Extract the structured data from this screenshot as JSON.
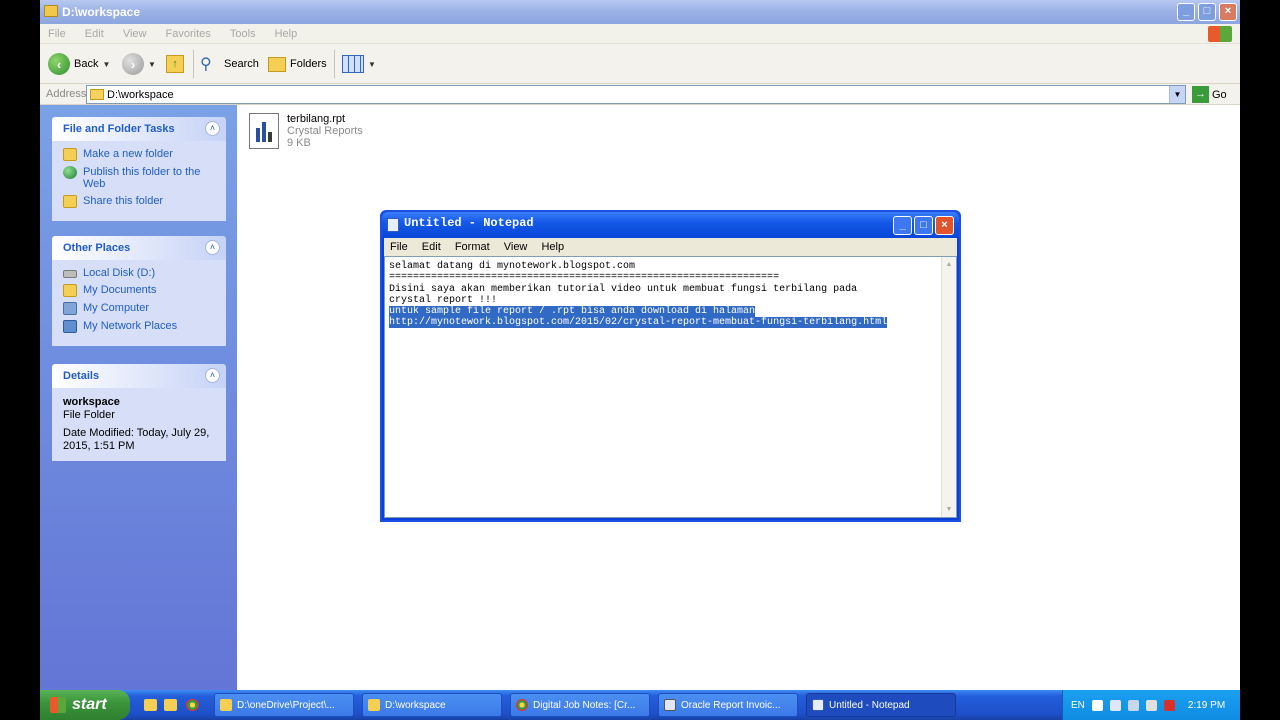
{
  "explorer": {
    "title": "D:\\workspace",
    "menu": [
      "File",
      "Edit",
      "View",
      "Favorites",
      "Tools",
      "Help"
    ],
    "toolbar": {
      "back_label": "Back",
      "search_label": "Search",
      "folders_label": "Folders"
    },
    "address": {
      "label": "Address",
      "value": "D:\\workspace",
      "go_label": "Go"
    },
    "file_tasks": {
      "title": "File and Folder Tasks",
      "items": [
        "Make a new folder",
        "Publish this folder to the Web",
        "Share this folder"
      ]
    },
    "other_places": {
      "title": "Other Places",
      "items": [
        "Local Disk (D:)",
        "My Documents",
        "My Computer",
        "My Network Places"
      ]
    },
    "details": {
      "title": "Details",
      "name": "workspace",
      "type": "File Folder",
      "modified": "Date Modified: Today, July 29, 2015, 1:51 PM"
    },
    "files": [
      {
        "name": "terbilang.rpt",
        "type": "Crystal Reports",
        "size": "9 KB"
      }
    ]
  },
  "notepad": {
    "title": "Untitled - Notepad",
    "menu": [
      "File",
      "Edit",
      "Format",
      "View",
      "Help"
    ],
    "lines": [
      "selamat datang di mynotework.blogspot.com",
      "=================================================================",
      "",
      "Disini saya akan memberikan tutorial video untuk membuat fungsi terbilang pada",
      "crystal report !!!",
      ""
    ],
    "selected_lines": [
      "untuk sample file report / .rpt bisa anda download di halaman",
      "http://mynotework.blogspot.com/2015/02/crystal-report-membuat-fungsi-terbilang.html"
    ]
  },
  "taskbar": {
    "start_label": "start",
    "buttons": [
      {
        "label": "D:\\oneDrive\\Project\\...",
        "active": false
      },
      {
        "label": "D:\\workspace",
        "active": false
      },
      {
        "label": "Digital Job Notes: [Cr...",
        "active": false
      },
      {
        "label": "Oracle Report Invoic...",
        "active": false
      },
      {
        "label": "Untitled - Notepad",
        "active": true
      }
    ],
    "tray": {
      "lang": "EN",
      "time": "2:19 PM"
    }
  },
  "colors": {
    "xp_blue": "#245edb",
    "task_link": "#215dc6",
    "selection": "#316ac5"
  }
}
